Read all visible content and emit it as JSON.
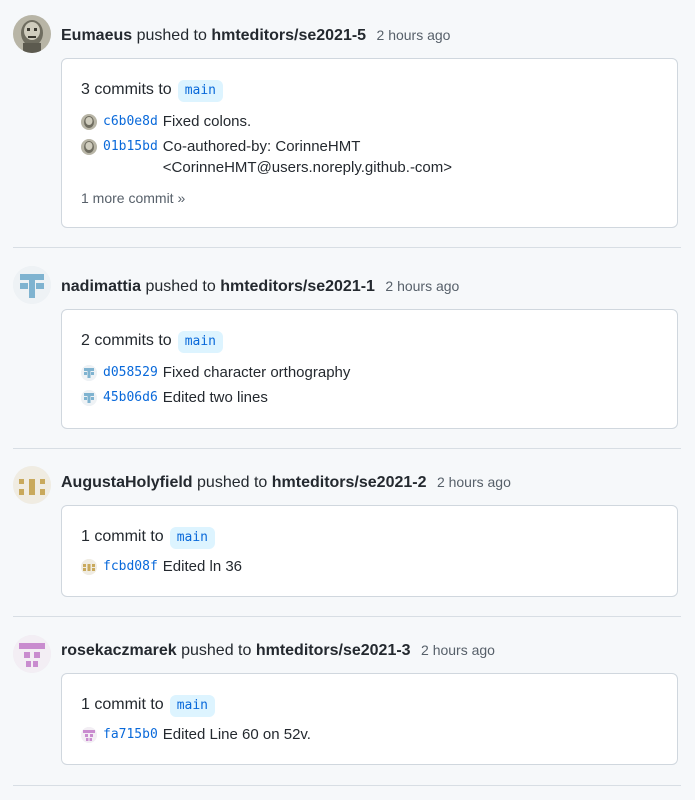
{
  "events": [
    {
      "user": "Eumaeus",
      "verb": "pushed to",
      "repo": "hmteditors/se2021-5",
      "time": "2 hours ago",
      "summary": "3 commits to",
      "branch": "main",
      "avatar_colors": [
        "#8a8a7a",
        "#c9c6b8"
      ],
      "commits": [
        {
          "sha": "c6b0e8d",
          "message": "Fixed colons."
        },
        {
          "sha": "01b15bd",
          "message": "Co-authored-by: CorinneHMT <CorinneHMT@users.noreply.github.-com>"
        }
      ],
      "more": "1 more commit »"
    },
    {
      "user": "nadimattia",
      "verb": "pushed to",
      "repo": "hmteditors/se2021-1",
      "time": "2 hours ago",
      "summary": "2 commits to",
      "branch": "main",
      "avatar_colors": [
        "#7fb3d0",
        "#eef2f5"
      ],
      "commits": [
        {
          "sha": "d058529",
          "message": "Fixed character orthography"
        },
        {
          "sha": "45b06d6",
          "message": "Edited two lines"
        }
      ]
    },
    {
      "user": "AugustaHolyfield",
      "verb": "pushed to",
      "repo": "hmteditors/se2021-2",
      "time": "2 hours ago",
      "summary": "1 commit to",
      "branch": "main",
      "avatar_colors": [
        "#c9a95c",
        "#f0ece2"
      ],
      "commits": [
        {
          "sha": "fcbd08f",
          "message": "Edited ln 36"
        }
      ]
    },
    {
      "user": "rosekaczmarek",
      "verb": "pushed to",
      "repo": "hmteditors/se2021-3",
      "time": "2 hours ago",
      "summary": "1 commit to",
      "branch": "main",
      "avatar_colors": [
        "#c98ccf",
        "#f3eef4"
      ],
      "commits": [
        {
          "sha": "fa715b0",
          "message": "Edited Line 60 on 52v."
        }
      ]
    }
  ]
}
